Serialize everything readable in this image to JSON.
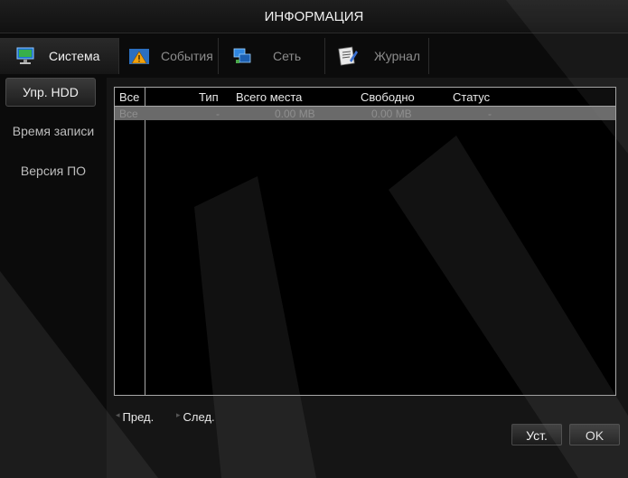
{
  "window": {
    "title": "ИНФОРМАЦИЯ"
  },
  "tabs": [
    {
      "label": "Система",
      "icon": "monitor-icon",
      "active": true
    },
    {
      "label": "События",
      "icon": "warning-icon",
      "active": false
    },
    {
      "label": "Сеть",
      "icon": "network-icon",
      "active": false
    },
    {
      "label": "Журнал",
      "icon": "log-icon",
      "active": false
    }
  ],
  "sidebar": {
    "items": [
      {
        "label": "Упр. HDD",
        "active": true
      },
      {
        "label": "Время записи",
        "active": false
      },
      {
        "label": "Версия ПО",
        "active": false
      }
    ]
  },
  "table": {
    "columns": [
      "Все",
      "Тип",
      "Всего места",
      "Свободно",
      "Статус"
    ],
    "rows": [
      [
        "Все",
        "-",
        "0.00 MB",
        "0.00 MB",
        "-"
      ]
    ]
  },
  "pager": {
    "prev": "Пред.",
    "next": "След."
  },
  "buttons": {
    "apply": "Уст.",
    "ok": "OK"
  },
  "colors": {
    "background": "#0b0b0b",
    "row_highlight": "#6a6a6a",
    "grid_line": "#a8a8a8"
  }
}
